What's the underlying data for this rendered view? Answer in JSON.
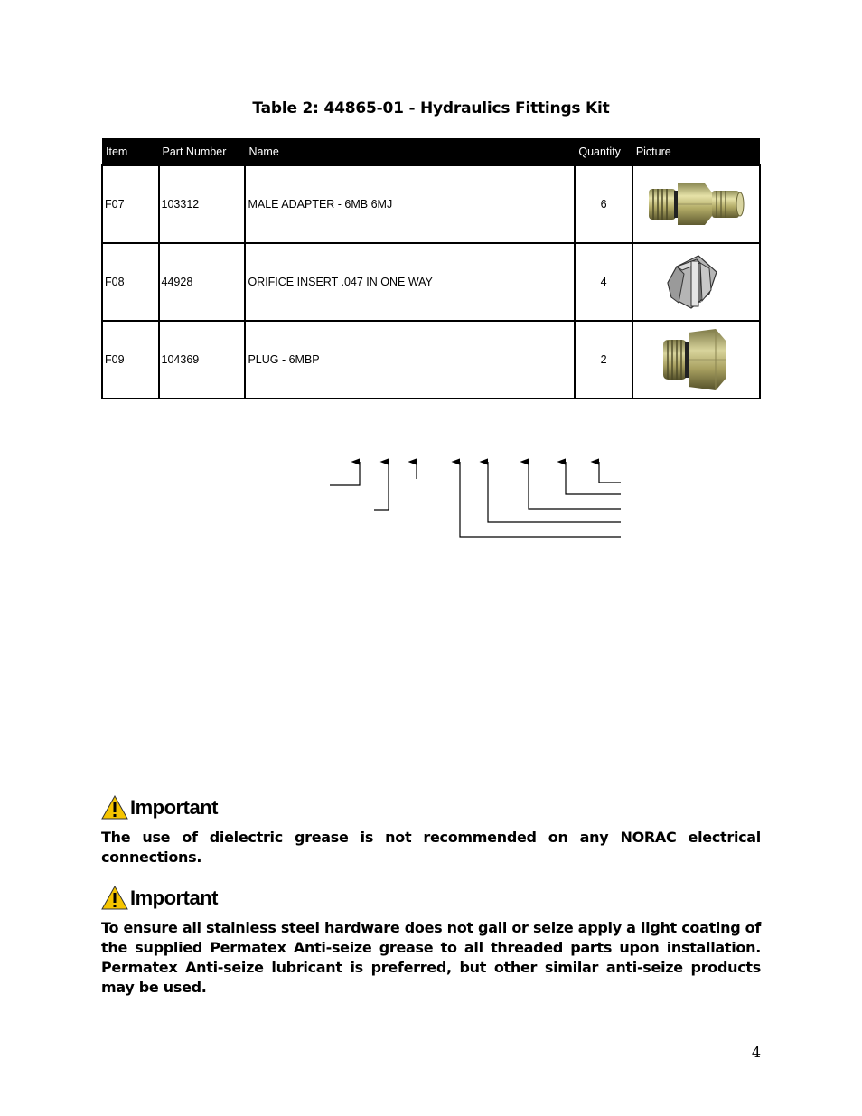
{
  "table": {
    "title": "Table 2: 44865-01 - Hydraulics Fittings Kit",
    "headers": [
      "Item",
      "Part Number",
      "Name",
      "Quantity",
      "Picture"
    ],
    "rows": [
      {
        "item": "F07",
        "part_number": "103312",
        "name": "MALE ADAPTER -  6MB 6MJ",
        "quantity": "6",
        "picture": "male-adapter-fitting"
      },
      {
        "item": "F08",
        "part_number": "44928",
        "name": "ORIFICE INSERT .047 IN ONE WAY",
        "quantity": "4",
        "picture": "orifice-insert"
      },
      {
        "item": "F09",
        "part_number": "104369",
        "name": "PLUG - 6MBP",
        "quantity": "2",
        "picture": "plug-fitting"
      }
    ]
  },
  "notes": [
    {
      "heading": "Important",
      "icon": "warning-triangle-icon",
      "text": "The use of dielectric grease is not recommended on any NORAC electrical connections."
    },
    {
      "heading": "Important",
      "icon": "warning-triangle-icon",
      "text": "To ensure all stainless steel hardware does not gall or seize apply a light coating of the supplied Permatex Anti-seize grease to all threaded parts upon installation. Permatex Anti-seize lubricant is preferred, but other similar anti-seize products may be used."
    }
  ],
  "page_number": "4"
}
